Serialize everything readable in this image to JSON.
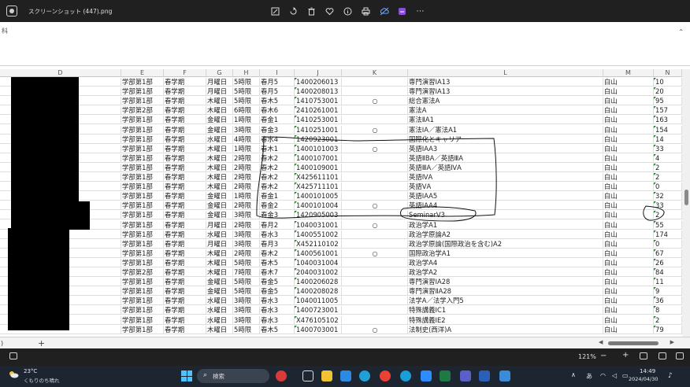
{
  "viewer": {
    "title": "スクリーンショット (447).png",
    "icons": [
      "image-edit-icon",
      "rotate-icon",
      "trash-icon",
      "heart-icon",
      "info-icon",
      "print-icon",
      "cloud-icon",
      "clipchamp-icon",
      "more-icon"
    ],
    "more_glyph": "⋯"
  },
  "excel": {
    "formula_text": "科",
    "columns": [
      {
        "label": "D",
        "width": 154
      },
      {
        "label": "E",
        "width": 54
      },
      {
        "label": "F",
        "width": 54
      },
      {
        "label": "G",
        "width": 34
      },
      {
        "label": "H",
        "width": 34
      },
      {
        "label": "I",
        "width": 44
      },
      {
        "label": "J",
        "width": 60
      },
      {
        "label": "K",
        "width": 84
      },
      {
        "label": "L",
        "width": 248
      },
      {
        "label": "M",
        "width": 64
      },
      {
        "label": "N",
        "width": 36
      }
    ],
    "rows": [
      [
        "学部第1部",
        "春学期",
        "月曜日",
        "5時限",
        "春月5",
        "1400206013",
        "",
        "専門演習ⅠA13",
        "白山",
        "10"
      ],
      [
        "学部第1部",
        "春学期",
        "月曜日",
        "5時限",
        "春月5",
        "1400208013",
        "",
        "専門演習ⅠA13",
        "白山",
        "20"
      ],
      [
        "学部第1部",
        "春学期",
        "木曜日",
        "5時限",
        "春木5",
        "1410753001",
        "○",
        "総合憲法A",
        "白山",
        "95"
      ],
      [
        "学部第2部",
        "春学期",
        "木曜日",
        "6時限",
        "春木6",
        "2410261001",
        "",
        "憲法A",
        "白山",
        "157"
      ],
      [
        "学部第1部",
        "春学期",
        "金曜日",
        "1時限",
        "春金1",
        "1410253001",
        "",
        "憲法ⅡA1",
        "白山",
        "163"
      ],
      [
        "学部第1部",
        "春学期",
        "金曜日",
        "3時限",
        "春金3",
        "1410251001",
        "○",
        "憲法ⅠA／憲法A1",
        "白山",
        "154"
      ],
      [
        "学部第1部",
        "春学期",
        "水曜日",
        "4時限",
        "春水4",
        "1420923001",
        "",
        "国際化とキャリア",
        "白山",
        "14"
      ],
      [
        "学部第1部",
        "春学期",
        "木曜日",
        "1時限",
        "春木1",
        "1400101003",
        "○",
        "英語ⅠAA3",
        "白山",
        "33"
      ],
      [
        "学部第1部",
        "春学期",
        "木曜日",
        "2時限",
        "春木2",
        "1400107001",
        "",
        "英語ⅡBA／英語ⅢA",
        "白山",
        "4"
      ],
      [
        "学部第1部",
        "春学期",
        "木曜日",
        "2時限",
        "春木2",
        "1400109001",
        "",
        "英語ⅢA／英語ⅣA",
        "白山",
        "2"
      ],
      [
        "学部第1部",
        "春学期",
        "木曜日",
        "2時限",
        "春木2",
        "X425611101",
        "",
        "英語ⅣA",
        "白山",
        "2"
      ],
      [
        "学部第1部",
        "春学期",
        "木曜日",
        "2時限",
        "春木2",
        "X425711101",
        "",
        "英語ⅤA",
        "白山",
        "0"
      ],
      [
        "学部第1部",
        "春学期",
        "金曜日",
        "1時限",
        "春金1",
        "1400101005",
        "",
        "英語ⅠAA5",
        "白山",
        "32"
      ],
      [
        "学部第1部",
        "春学期",
        "金曜日",
        "2時限",
        "春金2",
        "1400101004",
        "○",
        "英語ⅠAA4",
        "白山",
        "33"
      ],
      [
        "学部第1部",
        "春学期",
        "金曜日",
        "3時限",
        "春金3",
        "1420905003",
        "",
        "SeminarⅤ3",
        "白山",
        "2"
      ],
      [
        "学部第1部",
        "春学期",
        "月曜日",
        "2時限",
        "春月2",
        "1040031001",
        "○",
        "政治学A1",
        "白山",
        "55"
      ],
      [
        "学部第1部",
        "春学期",
        "水曜日",
        "3時限",
        "春水3",
        "1400551002",
        "",
        "政治学原論A2",
        "白山",
        "174"
      ],
      [
        "学部第1部",
        "春学期",
        "月曜日",
        "3時限",
        "春月3",
        "X452110102",
        "",
        "政治学原論(国際政治を含む)A2",
        "白山",
        "0"
      ],
      [
        "学部第1部",
        "春学期",
        "木曜日",
        "2時限",
        "春木2",
        "1400561001",
        "○",
        "国際政治学A1",
        "白山",
        "67"
      ],
      [
        "学部第1部",
        "春学期",
        "木曜日",
        "5時限",
        "春木5",
        "1040031004",
        "",
        "政治学A4",
        "白山",
        "26"
      ],
      [
        "学部第2部",
        "春学期",
        "木曜日",
        "7時限",
        "春木7",
        "2040031002",
        "",
        "政治学A2",
        "白山",
        "84"
      ],
      [
        "学部第1部",
        "春学期",
        "金曜日",
        "5時限",
        "春金5",
        "1400206028",
        "",
        "専門演習ⅠA28",
        "白山",
        "11"
      ],
      [
        "学部第1部",
        "春学期",
        "金曜日",
        "5時限",
        "春金5",
        "1400208028",
        "",
        "専門演習ⅡA28",
        "白山",
        "9"
      ],
      [
        "学部第1部",
        "春学期",
        "水曜日",
        "3時限",
        "春水3",
        "1040011005",
        "",
        "法学A／法学入門5",
        "白山",
        "36"
      ],
      [
        "学部第1部",
        "春学期",
        "水曜日",
        "3時限",
        "春水3",
        "1400723001",
        "",
        "特殊講義ⅠC1",
        "白山",
        "8"
      ],
      [
        "学部第1部",
        "春学期",
        "水曜日",
        "3時限",
        "春水3",
        "X476105102",
        "",
        "特殊講義ⅠE2",
        "白山",
        "2"
      ],
      [
        "学部第1部",
        "春学期",
        "木曜日",
        "5時限",
        "春木5",
        "1400703001",
        "○",
        "法制史(西洋)A",
        "白山",
        "79"
      ]
    ],
    "sheet_tab_label": ")",
    "sheet_add": "+"
  },
  "zoom": {
    "level": "121%",
    "minus": "−",
    "plus": "+"
  },
  "taskbar": {
    "temperature": "23°C",
    "weather": "くもりのち晴れ",
    "search_placeholder": "検索",
    "time": "14:49",
    "date": "2024/04/30"
  },
  "colors": {
    "viewer_bg": "#202020",
    "taskbar_bg": "#1c2530",
    "accent_blue": "#4cc2ff",
    "excel_green": "#2e7d32"
  }
}
